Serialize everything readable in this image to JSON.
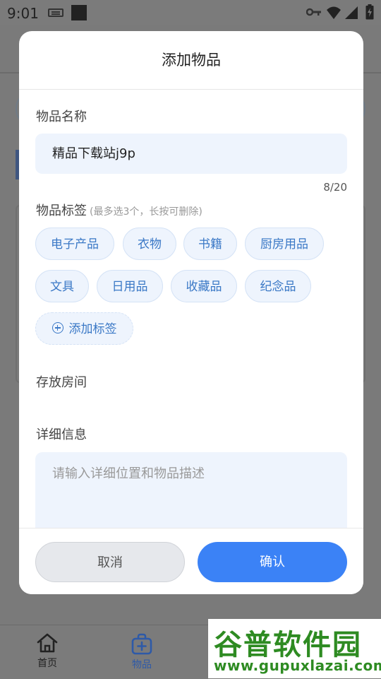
{
  "status_bar": {
    "time": "9:01"
  },
  "modal": {
    "title": "添加物品",
    "name_section": {
      "label": "物品名称",
      "value": "精品下载站j9p",
      "counter": "8/20"
    },
    "tag_section": {
      "label": "物品标签",
      "hint": "(最多选3个，长按可删除)",
      "tags": [
        "电子产品",
        "衣物",
        "书籍",
        "厨房用品",
        "文具",
        "日用品",
        "收藏品",
        "纪念品"
      ],
      "add_label": "添加标签"
    },
    "room_section": {
      "label": "存放房间"
    },
    "detail_section": {
      "label": "详细信息",
      "placeholder": "请输入详细位置和物品描述"
    },
    "buttons": {
      "cancel": "取消",
      "confirm": "确认"
    }
  },
  "bottom_nav": {
    "items": [
      {
        "label": "首页",
        "icon": "home-icon"
      },
      {
        "label": "物品",
        "icon": "bag-plus-icon"
      }
    ]
  },
  "watermark": {
    "text": "谷普软件园",
    "url": "www.gupuxlazai.com"
  }
}
